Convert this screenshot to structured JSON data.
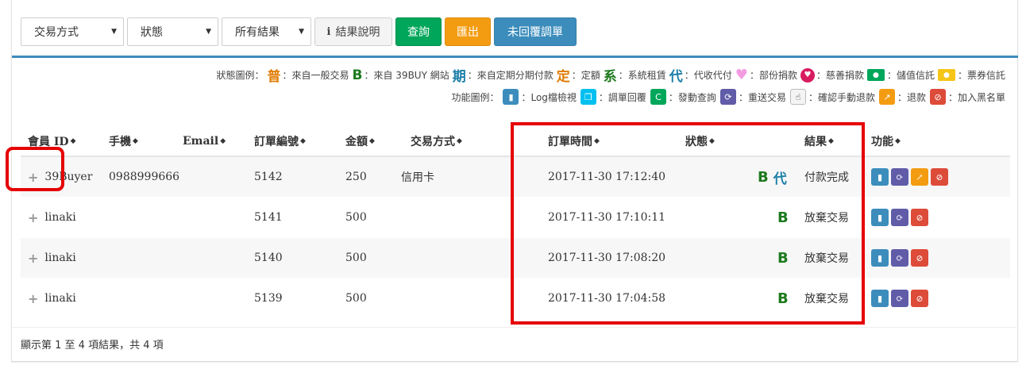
{
  "toolbar": {
    "trade_method": "交易方式",
    "status": "狀態",
    "all_results": "所有結果",
    "result_info": "結果說明",
    "query": "查詢",
    "export": "匯出",
    "unreplied": "未回覆調單"
  },
  "legend1": {
    "title": "狀態圖例：",
    "items": [
      {
        "ch": "普",
        "color": "#e07b00",
        "text": "：來自一般交易"
      },
      {
        "ch": "B",
        "color": "#1d7a1d",
        "text": "：來自 39BUY 網站"
      },
      {
        "ch": "期",
        "color": "#1d7fa8",
        "text": "：來自定期分期付款"
      },
      {
        "ch": "定",
        "color": "#e07b00",
        "text": "：定額"
      },
      {
        "ch": "系",
        "color": "#1d7a1d",
        "text": "：系統租賃"
      },
      {
        "ch": "代",
        "color": "#1d7fa8",
        "text": "：代收代付"
      }
    ],
    "partial_donation": "：部份捐款",
    "charity_donation": "：慈善捐款",
    "stored_value": "：儲值信託",
    "voucher": "：票券信託"
  },
  "legend2": {
    "title": "功能圖例：",
    "log": "：Log檔檢視",
    "reply": "：調單回覆",
    "query": "：發動查詢",
    "resend": "：重送交易",
    "manual_refund": "：確認手動退款",
    "refund": "：退款",
    "blacklist": "：加入黑名單"
  },
  "table": {
    "headers": {
      "member": "會員 ID",
      "phone": "手機",
      "email": "Email",
      "order": "訂單編號",
      "amount": "金額",
      "method": "交易方式",
      "time": "訂單時間",
      "status": "狀態",
      "result": "結果",
      "function": "功能"
    },
    "rows": [
      {
        "member": "39Buyer",
        "phone": "0988999666",
        "email": "",
        "order": "5142",
        "amount": "250",
        "method": "信用卡",
        "time": "2017-11-30 17:12:40",
        "status_b": "B",
        "status_d": "代",
        "result": "付款完成"
      },
      {
        "member": "linaki",
        "phone": "",
        "email": "",
        "order": "5141",
        "amount": "500",
        "method": "",
        "time": "2017-11-30 17:10:11",
        "status_b": "B",
        "status_d": "",
        "result": "放棄交易"
      },
      {
        "member": "linaki",
        "phone": "",
        "email": "",
        "order": "5140",
        "amount": "500",
        "method": "",
        "time": "2017-11-30 17:08:20",
        "status_b": "B",
        "status_d": "",
        "result": "放棄交易"
      },
      {
        "member": "linaki",
        "phone": "",
        "email": "",
        "order": "5139",
        "amount": "500",
        "method": "",
        "time": "2017-11-30 17:04:58",
        "status_b": "B",
        "status_d": "",
        "result": "放棄交易"
      }
    ]
  },
  "footer": {
    "summary": "顯示第 1 至 4 項結果，共 4 項"
  }
}
